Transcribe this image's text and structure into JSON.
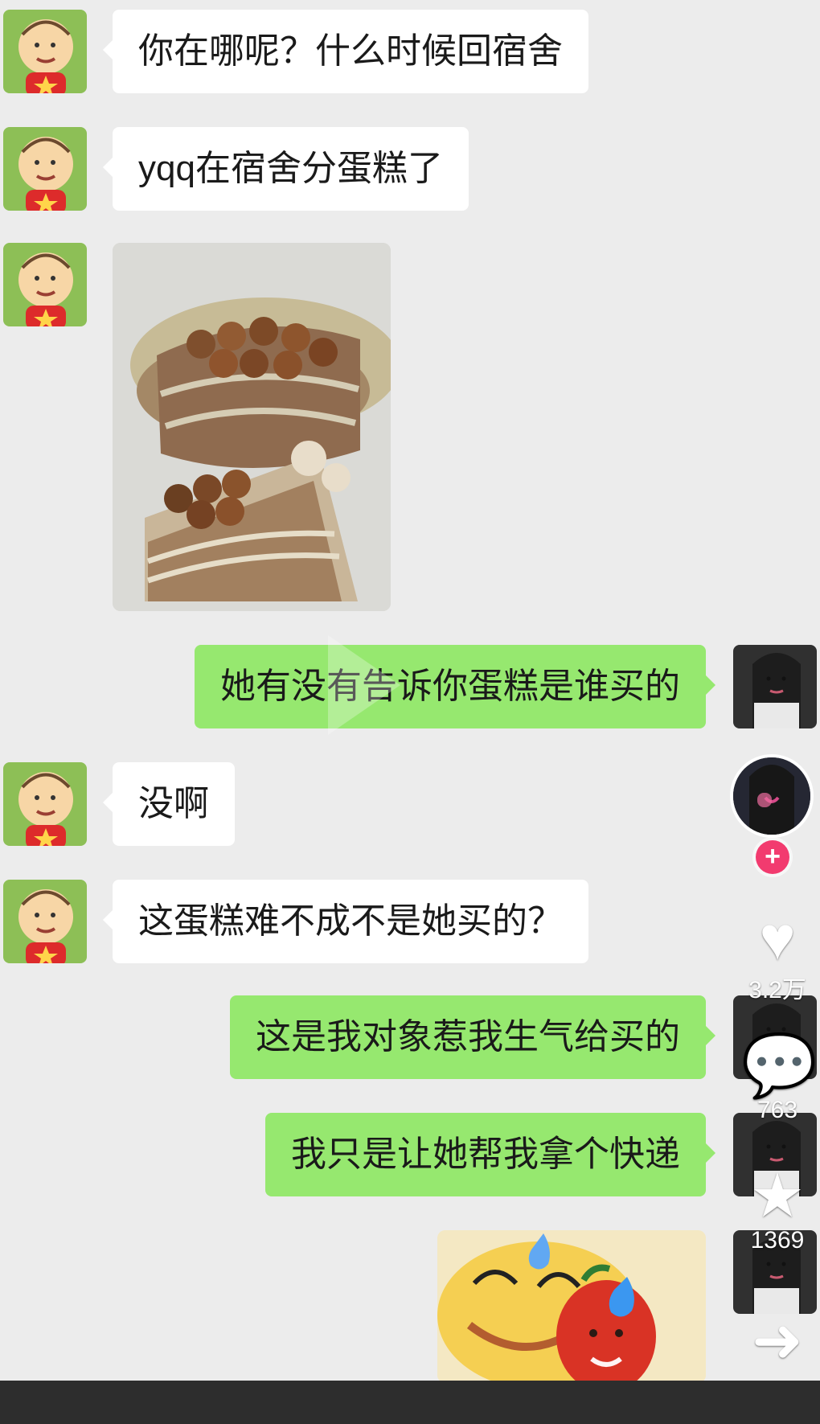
{
  "messages": [
    {
      "side": "left",
      "text": "你在哪呢？什么时候回宿舍"
    },
    {
      "side": "left",
      "text": "yqq在宿舍分蛋糕了"
    },
    {
      "side": "left",
      "type": "image",
      "content": "cake-photo"
    },
    {
      "side": "right",
      "text": "她有没有告诉你蛋糕是谁买的"
    },
    {
      "side": "left",
      "text": "没啊"
    },
    {
      "side": "left",
      "text": "这蛋糕难不成不是她买的？"
    },
    {
      "side": "right",
      "text": "这是我对象惹我生气给买的"
    },
    {
      "side": "right",
      "text": "我只是让她帮我拿个快递"
    },
    {
      "side": "right",
      "type": "image",
      "content": "sticker-sweating-pepper"
    }
  ],
  "sidebar": {
    "like_count": "3.2万",
    "comment_count": "763",
    "favorite_count": "1369"
  },
  "colors": {
    "incoming_bubble": "#ffffff",
    "outgoing_bubble": "#96e86f",
    "background": "#ececec",
    "follow": "#f23b6f"
  }
}
